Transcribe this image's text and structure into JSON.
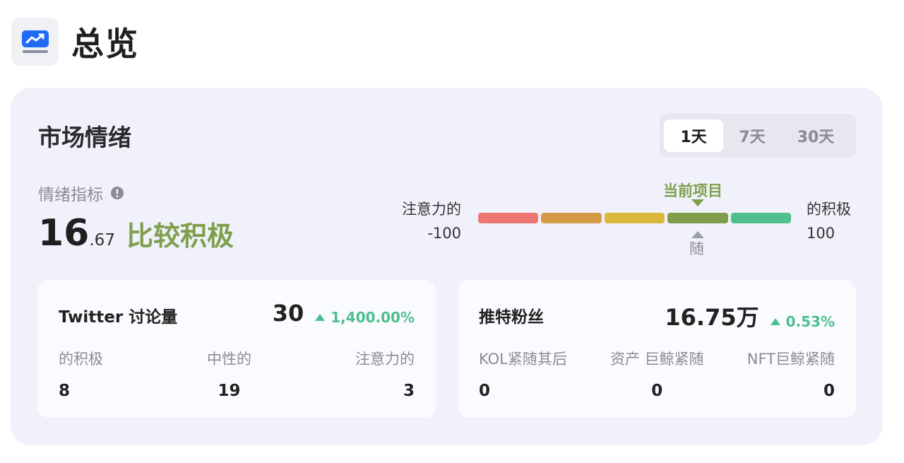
{
  "header": {
    "title": "总览",
    "icon": "chart-line-icon"
  },
  "sentiment": {
    "title": "市场情绪",
    "range_tabs": [
      {
        "label": "1天",
        "active": true
      },
      {
        "label": "7天",
        "active": false
      },
      {
        "label": "30天",
        "active": false
      }
    ],
    "indicator_label": "情绪指标",
    "value_int": "16",
    "value_dec": ".67",
    "sentiment_text": "比较积极",
    "gauge": {
      "left_label": "注意力的",
      "left_value": "-100",
      "right_label": "的积极",
      "right_value": "100",
      "current_label": "当前项目",
      "follow_label": "随",
      "segment_colors": [
        "#ee7670",
        "#d59a45",
        "#d9b83c",
        "#7e9d4d",
        "#4fbf90"
      ]
    }
  },
  "twitter_card": {
    "title": "Twitter 讨论量",
    "value": "30",
    "change": "1,400.00%",
    "stats": [
      {
        "label": "的积极",
        "value": "8"
      },
      {
        "label": "中性的",
        "value": "19"
      },
      {
        "label": "注意力的",
        "value": "3"
      }
    ]
  },
  "followers_card": {
    "title": "推特粉丝",
    "value": "16.75万",
    "change": "0.53%",
    "stats": [
      {
        "label": "KOL紧随其后",
        "value": "0"
      },
      {
        "label": "资产 巨鲸紧随",
        "value": "0"
      },
      {
        "label": "NFT巨鲸紧随",
        "value": "0"
      }
    ]
  },
  "colors": {
    "positive": "#7ea04d",
    "up": "#4cbf8f",
    "accent_blue": "#1f6bf5"
  }
}
